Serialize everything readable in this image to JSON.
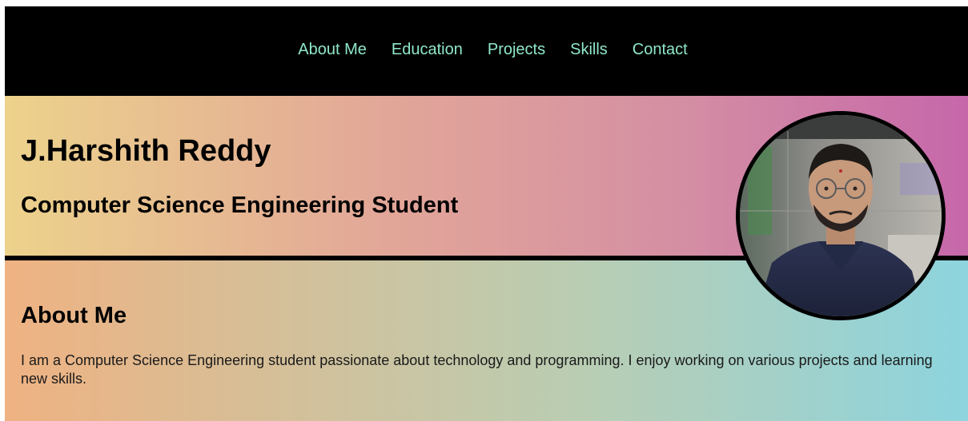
{
  "nav": {
    "items": [
      {
        "label": "About Me"
      },
      {
        "label": "Education"
      },
      {
        "label": "Projects"
      },
      {
        "label": "Skills"
      },
      {
        "label": "Contact"
      }
    ]
  },
  "hero": {
    "name": "J.Harshith Reddy",
    "subtitle": "Computer Science Engineering Student"
  },
  "about": {
    "heading": "About Me",
    "text": "I am a Computer Science Engineering student passionate about technology and programming. I enjoy working on various projects and learning new skills."
  },
  "colors": {
    "nav_link": "#8fe8c7",
    "navbar_bg": "#000000"
  }
}
